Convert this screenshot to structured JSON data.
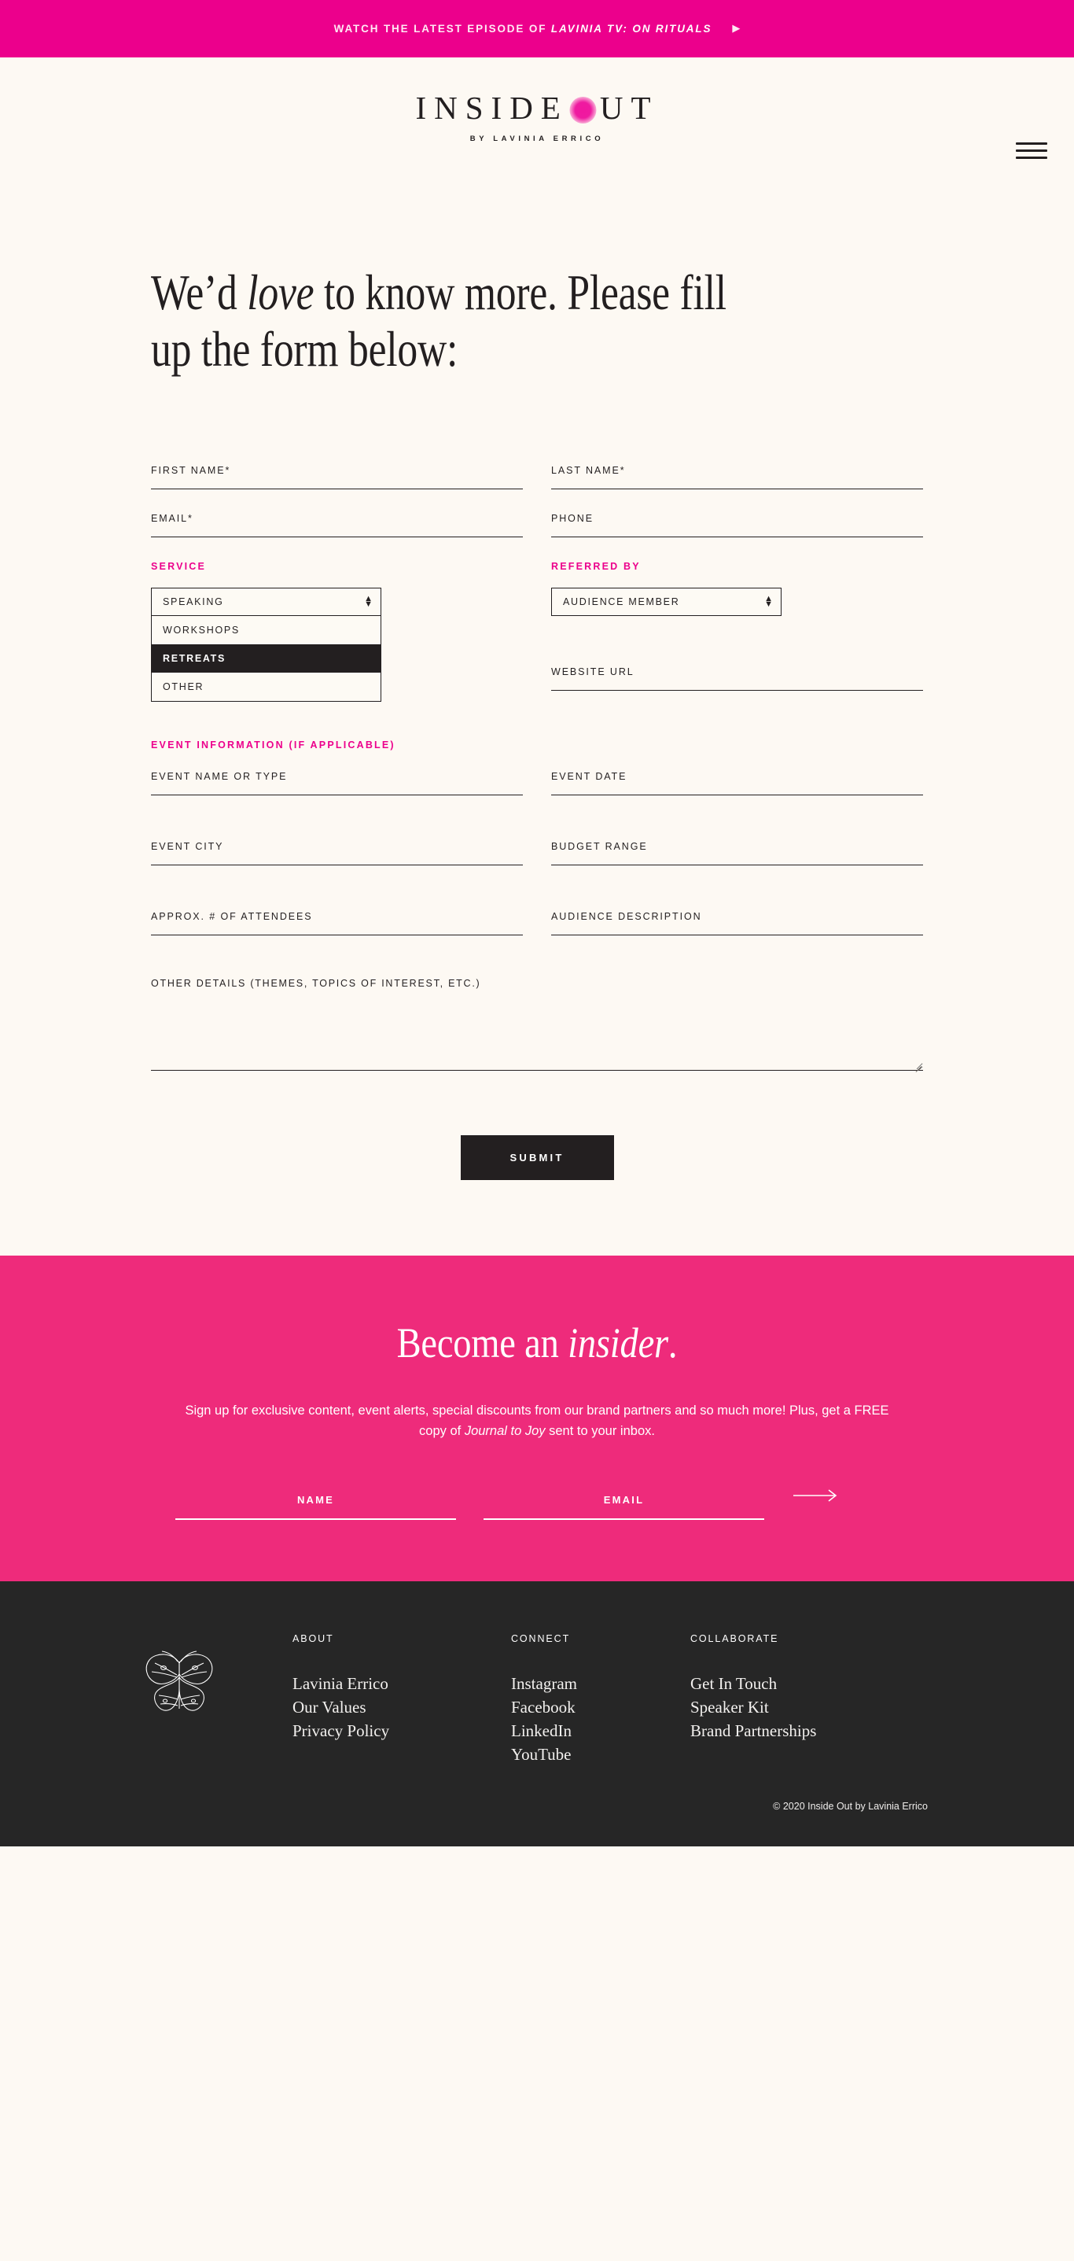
{
  "colors": {
    "announce_pink": "#ec008c",
    "insider_pink": "#ee2b7b",
    "cream": "#fdf9f3",
    "ink": "#231f20",
    "footer_dark": "#262626",
    "label_pink": "#ec008c"
  },
  "announcement": {
    "prefix": "WATCH THE LATEST EPISODE OF ",
    "show": "LAVINIA TV: ON RITUALS",
    "play_icon": "play-triangle-icon"
  },
  "header": {
    "logo_left": "INSIDE",
    "logo_right": "UT",
    "logo_dot": "pink-dot-o",
    "logo_sub": "BY LAVINIA ERRICO",
    "menu_icon": "hamburger-menu-icon"
  },
  "main": {
    "headline_part1": "We’d ",
    "headline_em": "love",
    "headline_part2": " to know more. Please fill up the form below:",
    "fields": {
      "first_name": "FIRST NAME*",
      "last_name": "LAST NAME*",
      "email": "EMAIL*",
      "phone": "PHONE",
      "website_url": "WEBSITE URL",
      "event_name": "EVENT NAME OR TYPE",
      "event_date": "EVENT DATE",
      "event_city": "EVENT CITY",
      "budget_range": "BUDGET RANGE",
      "attendees": "APPROX. # OF ATTENDEES",
      "audience_description": "AUDIENCE DESCRIPTION",
      "other_details": "OTHER DETAILS (THEMES, TOPICS OF INTEREST, ETC.)"
    },
    "values": {
      "first_name": "",
      "last_name": "",
      "email": "",
      "phone": "",
      "website_url": "",
      "event_name": "",
      "event_date": "",
      "event_city": "",
      "budget_range": "",
      "attendees": "",
      "audience_description": "",
      "other_details": ""
    },
    "service": {
      "label": "SERVICE",
      "selected": "SPEAKING",
      "open": true,
      "options": [
        "SPEAKING",
        "WORKSHOPS",
        "RETREATS",
        "OTHER"
      ],
      "visible_options": [
        {
          "label": "WORKSHOPS",
          "highlighted": false
        },
        {
          "label": "RETREATS",
          "highlighted": true
        },
        {
          "label": "OTHER",
          "highlighted": false
        }
      ]
    },
    "referred_by": {
      "label": "REFERRED BY",
      "selected": "AUDIENCE MEMBER"
    },
    "event_section_label": "EVENT INFORMATION (IF APPLICABLE)",
    "submit_label": "SUBMIT"
  },
  "insider": {
    "title_part1": "Become an ",
    "title_em": "insider",
    "title_part2": ".",
    "copy_part1": "Sign up for exclusive content, event alerts, special discounts from our brand partners and so much more! Plus, get a FREE copy of ",
    "copy_em": "Journal to Joy",
    "copy_part2": " sent to your inbox.",
    "name_label": "NAME",
    "name_value": "",
    "email_label": "EMAIL",
    "email_value": "",
    "submit_icon": "long-arrow-right-icon"
  },
  "footer": {
    "logo_icon": "butterfly-icon",
    "columns": [
      {
        "title": "ABOUT",
        "links": [
          "Lavinia Errico",
          "Our Values",
          "Privacy Policy"
        ]
      },
      {
        "title": "CONNECT",
        "links": [
          "Instagram",
          "Facebook",
          "LinkedIn",
          "YouTube"
        ]
      },
      {
        "title": "COLLABORATE",
        "links": [
          "Get In Touch",
          "Speaker Kit",
          "Brand Partnerships"
        ]
      }
    ],
    "copyright": "© 2020 Inside Out by Lavinia Errico"
  }
}
